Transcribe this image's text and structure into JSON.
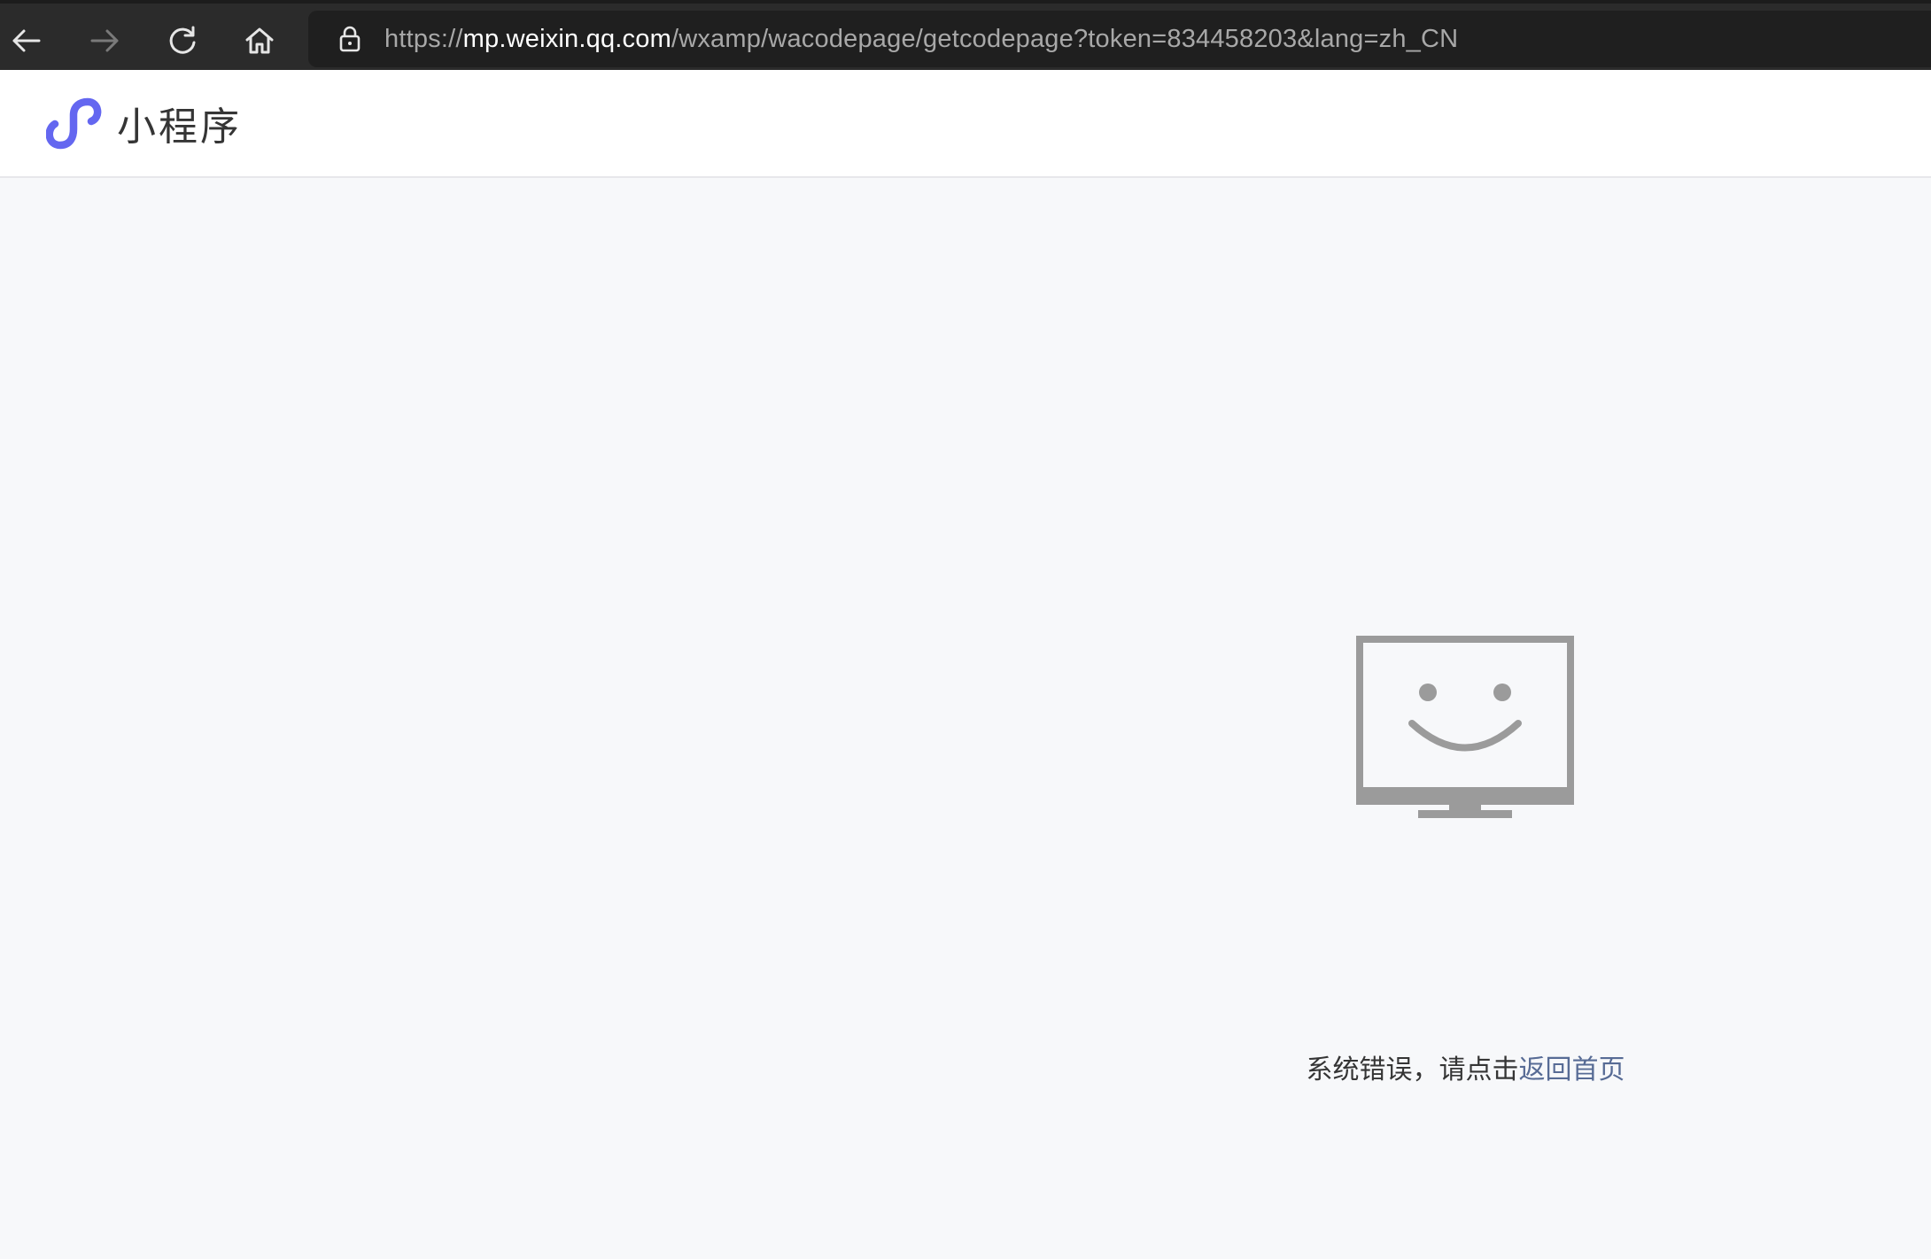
{
  "browser": {
    "url_scheme": "https://",
    "url_host": "mp.weixin.qq.com",
    "url_path": "/wxamp/wacodepage/getcodepage?token=834458203&lang=zh_CN",
    "icons": [
      "back-arrow-icon",
      "forward-arrow-icon",
      "reload-icon",
      "home-icon",
      "lock-icon"
    ]
  },
  "header": {
    "title": "小程序",
    "logo_icon": "miniprogram-logo-icon",
    "logo_color": "#6467f0"
  },
  "error": {
    "message": "系统错误，请点击",
    "link_label": "返回首页",
    "link_color": "#576b95",
    "illustration_icon": "smiling-monitor-icon",
    "illustration_color": "#9b9b9b"
  }
}
